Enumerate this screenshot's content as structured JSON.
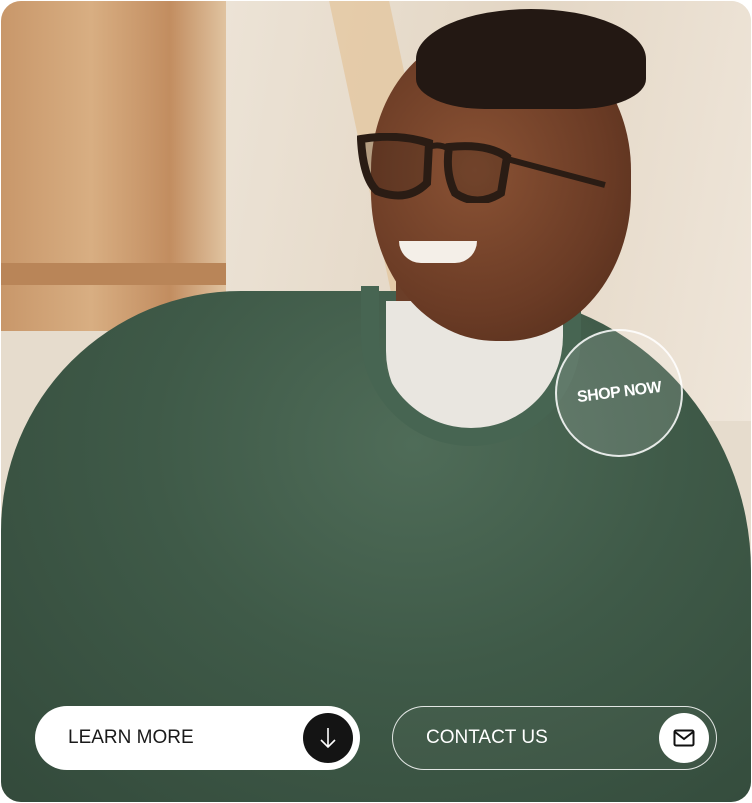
{
  "hero": {
    "shop_now_label": "SHOP NOW",
    "buttons": [
      {
        "label": "LEARN MORE",
        "icon": "arrow-down-icon"
      },
      {
        "label": "CONTACT US",
        "icon": "envelope-icon"
      }
    ]
  },
  "colors": {
    "sweater": "#3f5a48",
    "learn_button_bg": "#ffffff",
    "learn_icon_bg": "#141414"
  }
}
